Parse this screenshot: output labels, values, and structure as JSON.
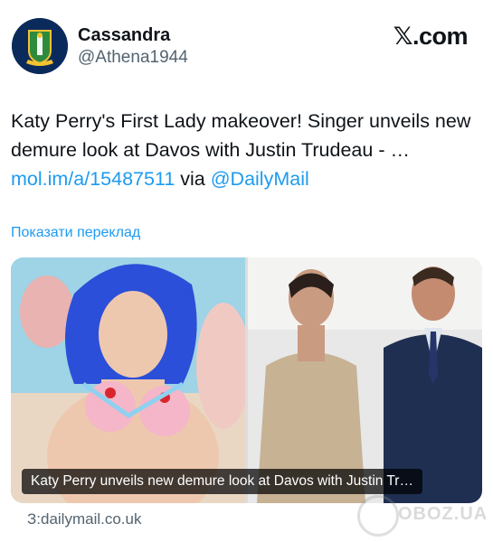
{
  "author": {
    "name": "Cassandra",
    "handle": "@Athena1944",
    "avatar_icon": "flag-crest-icon",
    "avatar_color": "#0b2a5c"
  },
  "site_logo": "𝕏.com",
  "tweet": {
    "text_before": "Katy Perry's First Lady makeover! Singer unveils new demure look at Davos with Justin Trudeau - … ",
    "link": "mol.im/a/15487511",
    "via": " via ",
    "mention": "@DailyMail"
  },
  "translate_label": "Показати переклад",
  "card": {
    "caption": "Katy Perry unveils new demure look at Davos with Justin Tr…",
    "domain": "З:dailymail.co.uk"
  },
  "watermark": "OBOZ.UA",
  "colors": {
    "link": "#1d9bf0",
    "secondary_text": "#536471"
  }
}
